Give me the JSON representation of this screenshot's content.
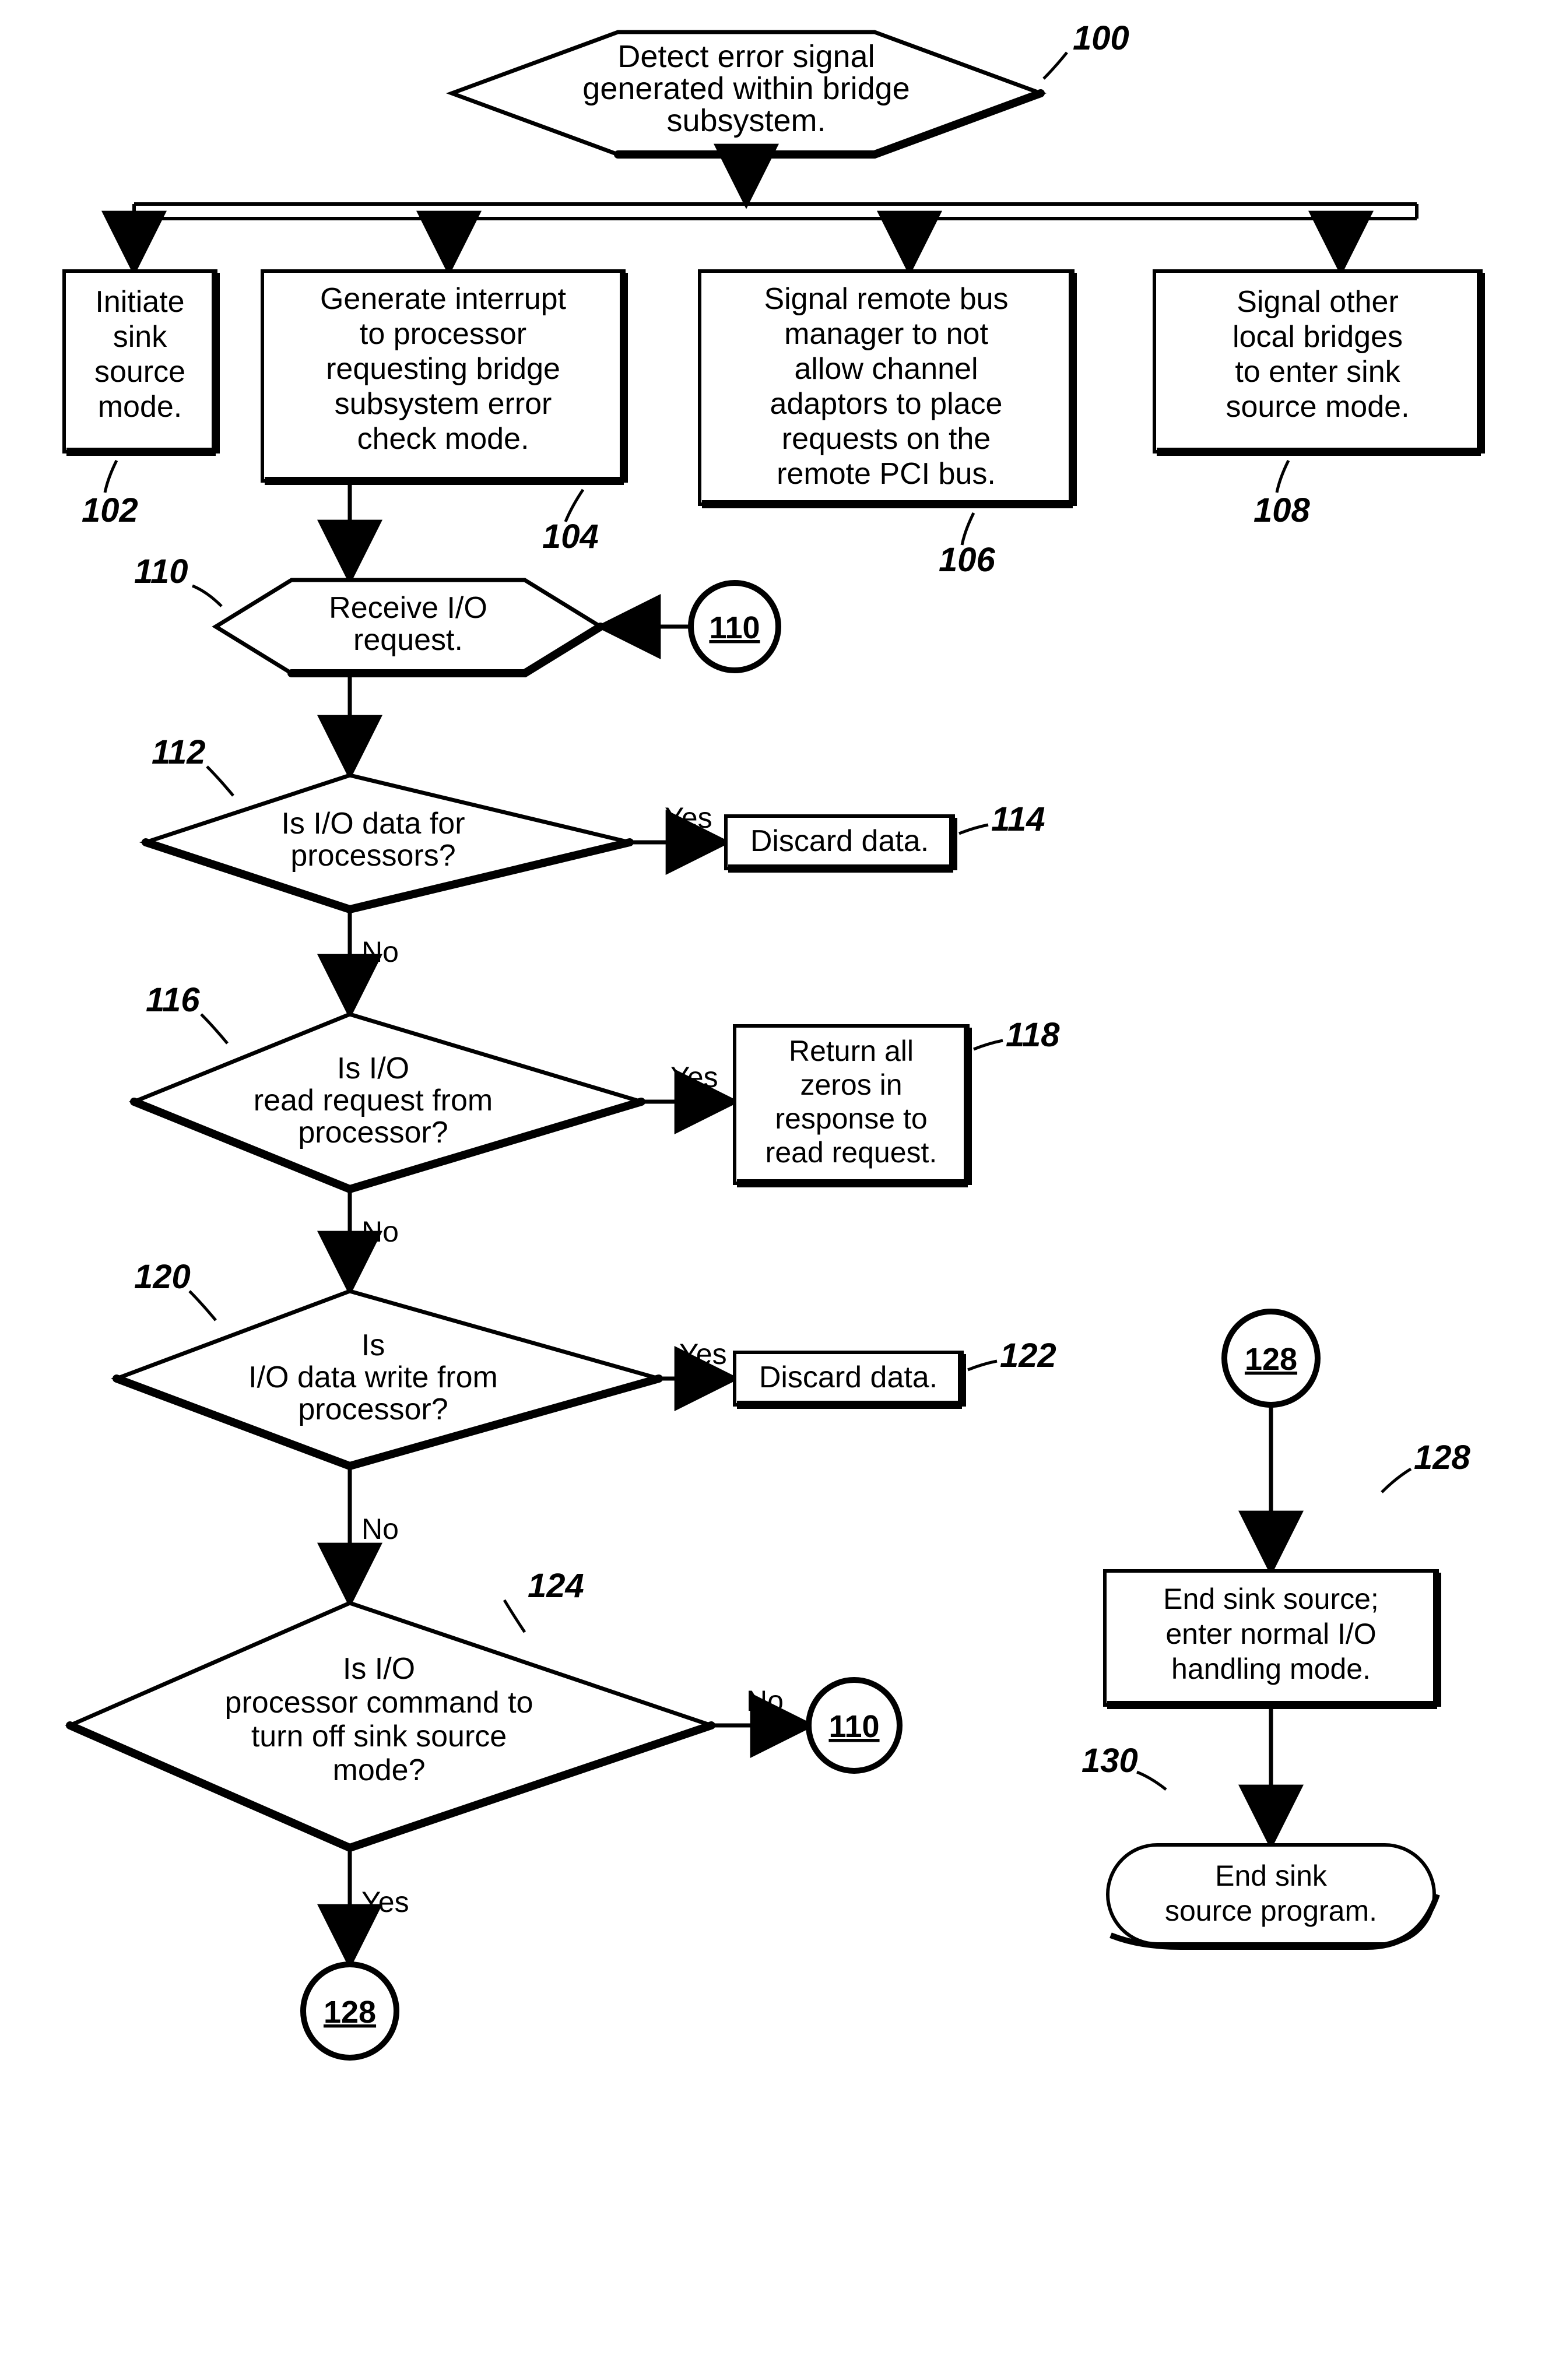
{
  "nodes": {
    "n100": {
      "ref": "100",
      "lines": [
        "Detect error signal",
        "generated within bridge",
        "subsystem."
      ]
    },
    "n102": {
      "ref": "102",
      "lines": [
        "Initiate",
        "sink",
        "source",
        "mode."
      ]
    },
    "n104": {
      "ref": "104",
      "lines": [
        "Generate interrupt",
        "to processor",
        "requesting bridge",
        "subsystem error",
        "check mode."
      ]
    },
    "n106": {
      "ref": "106",
      "lines": [
        "Signal remote bus",
        "manager to not",
        "allow channel",
        "adaptors to place",
        "requests on the",
        "remote PCI bus."
      ]
    },
    "n108": {
      "ref": "108",
      "lines": [
        "Signal other",
        "local bridges",
        "to enter sink",
        "source mode."
      ]
    },
    "n110": {
      "ref": "110",
      "lines": [
        "Receive I/O",
        "request."
      ]
    },
    "n112": {
      "ref": "112",
      "lines": [
        "Is I/O data for",
        "processors?"
      ]
    },
    "n114": {
      "ref": "114",
      "lines": [
        "Discard data."
      ]
    },
    "n116": {
      "ref": "116",
      "lines": [
        "Is I/O",
        "read request from",
        "processor?"
      ]
    },
    "n118": {
      "ref": "118",
      "lines": [
        "Return all",
        "zeros in",
        "response to",
        "read request."
      ]
    },
    "n120": {
      "ref": "120",
      "lines": [
        "Is",
        "I/O data write from",
        "processor?"
      ]
    },
    "n122": {
      "ref": "122",
      "lines": [
        "Discard data."
      ]
    },
    "n124": {
      "ref": "124",
      "lines": [
        "Is I/O",
        "processor command to",
        "turn off sink source",
        "mode?"
      ]
    },
    "n128": {
      "ref": "128",
      "lines": [
        "End sink source;",
        "enter normal I/O",
        "handling mode."
      ]
    },
    "n130": {
      "ref": "130",
      "lines": [
        "End sink",
        "source program."
      ]
    }
  },
  "connectors": {
    "c110a": "110",
    "c110b": "110",
    "c128a": "128",
    "c128b": "128"
  },
  "labels": {
    "yes": "Yes",
    "no": "No"
  }
}
